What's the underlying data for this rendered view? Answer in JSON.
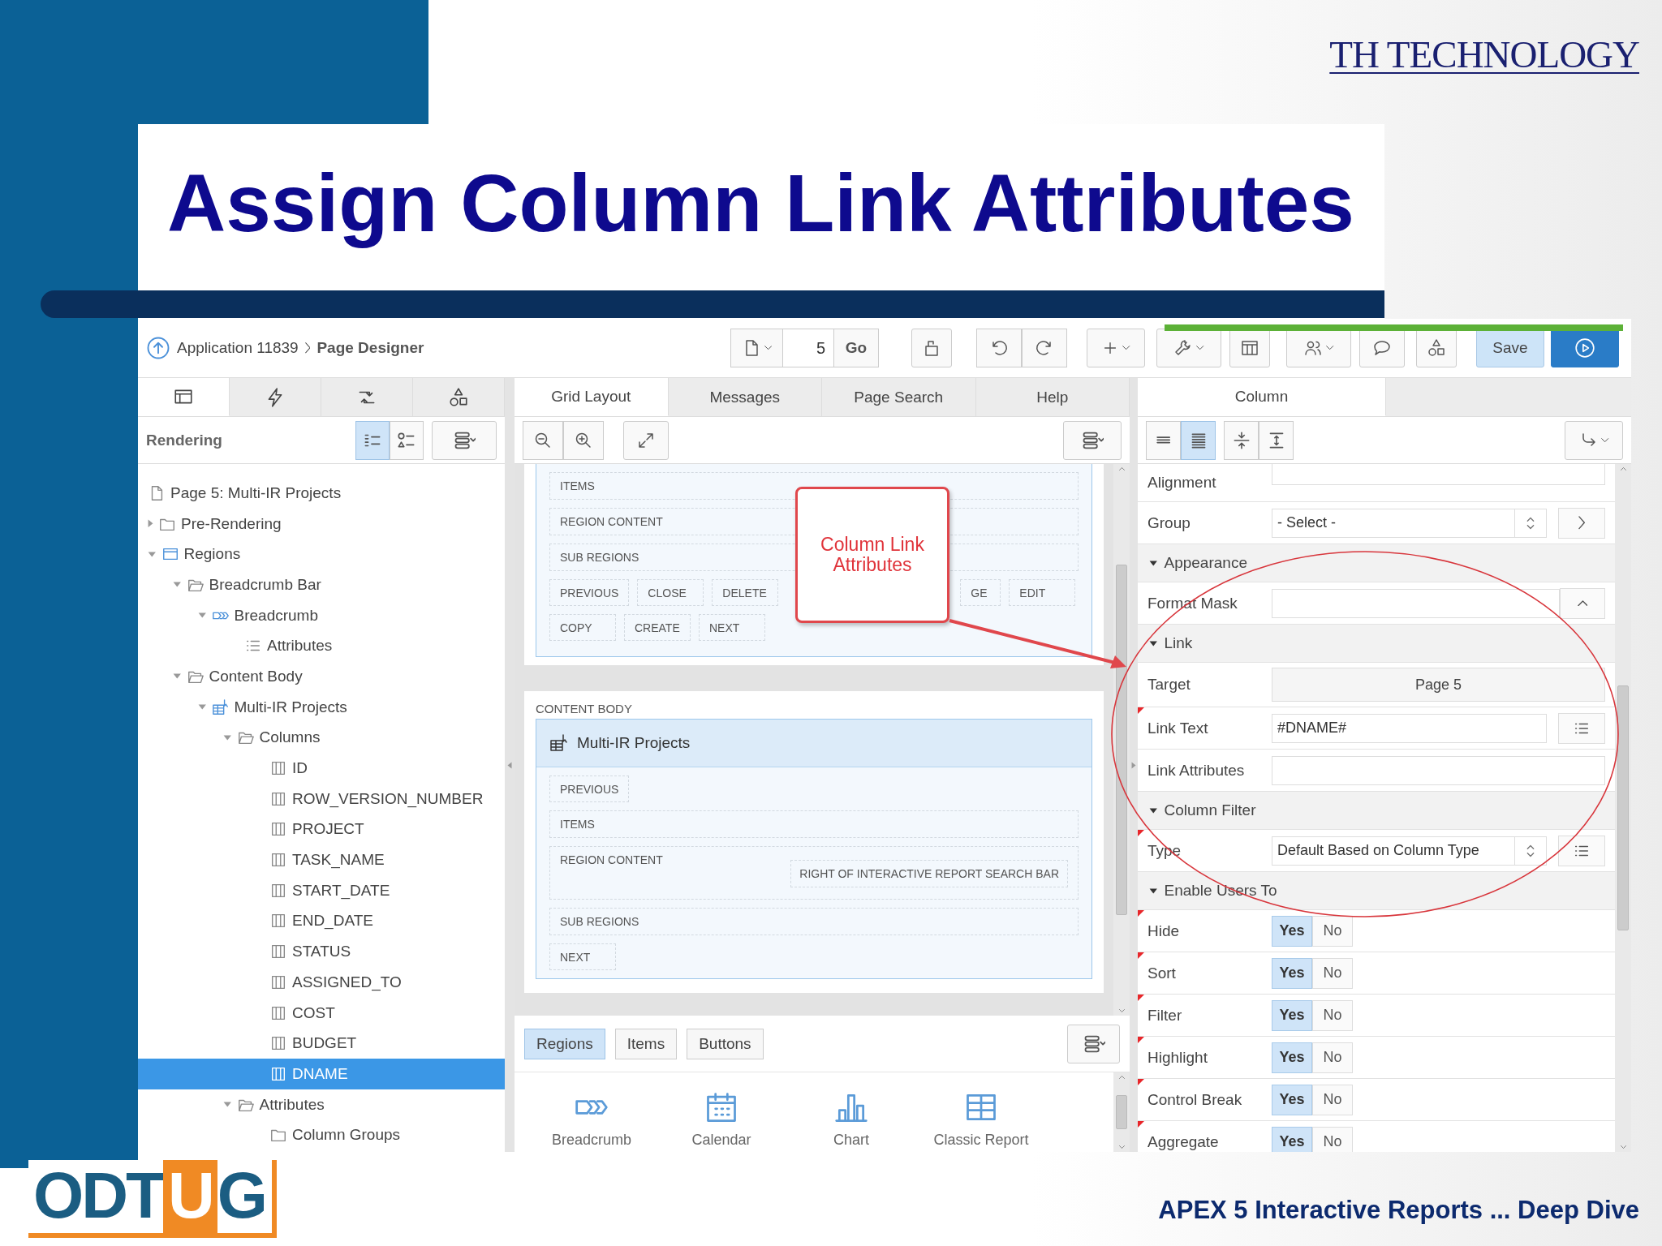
{
  "slide": {
    "brand": "TH TECHNOLOGY",
    "title": "Assign Column Link Attributes",
    "logo": [
      {
        "text": "ODT",
        "highlight": false
      },
      {
        "text": "U",
        "highlight": true
      },
      {
        "text": "G",
        "highlight": false
      }
    ],
    "footer": "APEX 5 Interactive Reports ... Deep Dive"
  },
  "app": {
    "breadcrumb": [
      {
        "label": "Application 11839",
        "current": false
      },
      {
        "label": "Page Designer",
        "current": true
      }
    ],
    "page_number": "5",
    "go": "Go",
    "save": "Save"
  },
  "left": {
    "tabs": [
      {
        "kind": "rendering",
        "selected": true
      },
      {
        "kind": "dynamic-actions",
        "selected": false
      },
      {
        "kind": "processing",
        "selected": false
      },
      {
        "kind": "shared",
        "selected": false
      }
    ],
    "heading": "Rendering",
    "views": [
      {
        "kind": "tree",
        "selected": true
      },
      {
        "kind": "components",
        "selected": false
      }
    ],
    "tree": [
      {
        "kind": "page",
        "label": "Page 5: Multi-IR Projects",
        "selected": false
      },
      {
        "kind": "folder",
        "label": "Pre-Rendering",
        "expanded": false,
        "selected": false
      },
      {
        "kind": "region",
        "label": "Regions",
        "expanded": true,
        "selected": false,
        "children": [
          {
            "kind": "folder",
            "label": "Breadcrumb Bar",
            "expanded": true,
            "selected": false,
            "children": [
              {
                "kind": "breadcrumb",
                "label": "Breadcrumb",
                "expanded": true,
                "selected": false,
                "children": [
                  {
                    "kind": "attributes",
                    "label": "Attributes",
                    "selected": false
                  }
                ]
              }
            ]
          },
          {
            "kind": "folder",
            "label": "Content Body",
            "expanded": true,
            "selected": false,
            "children": [
              {
                "kind": "report",
                "label": "Multi-IR Projects",
                "expanded": true,
                "selected": false,
                "children": [
                  {
                    "kind": "folder",
                    "label": "Columns",
                    "expanded": true,
                    "selected": false,
                    "children": [
                      {
                        "kind": "column",
                        "label": "ID",
                        "selected": false
                      },
                      {
                        "kind": "column",
                        "label": "ROW_VERSION_NUMBER",
                        "selected": false
                      },
                      {
                        "kind": "column",
                        "label": "PROJECT",
                        "selected": false
                      },
                      {
                        "kind": "column",
                        "label": "TASK_NAME",
                        "selected": false
                      },
                      {
                        "kind": "column",
                        "label": "START_DATE",
                        "selected": false
                      },
                      {
                        "kind": "column",
                        "label": "END_DATE",
                        "selected": false
                      },
                      {
                        "kind": "column",
                        "label": "STATUS",
                        "selected": false
                      },
                      {
                        "kind": "column",
                        "label": "ASSIGNED_TO",
                        "selected": false
                      },
                      {
                        "kind": "column",
                        "label": "COST",
                        "selected": false
                      },
                      {
                        "kind": "column",
                        "label": "BUDGET",
                        "selected": false
                      },
                      {
                        "kind": "column",
                        "label": "DNAME",
                        "selected": true
                      }
                    ]
                  },
                  {
                    "kind": "folder",
                    "label": "Attributes",
                    "expanded": true,
                    "selected": false,
                    "children": [
                      {
                        "kind": "folder",
                        "label": "Column Groups",
                        "selected": false
                      }
                    ]
                  }
                ]
              }
            ]
          }
        ]
      }
    ]
  },
  "center": {
    "tabs": [
      {
        "label": "Grid Layout",
        "selected": true
      },
      {
        "label": "Messages",
        "selected": false
      },
      {
        "label": "Page Search",
        "selected": false
      },
      {
        "label": "Help",
        "selected": false
      }
    ],
    "grid": [
      {
        "slots": [
          {
            "kind": "row",
            "label": "ITEMS"
          },
          {
            "kind": "row",
            "label": "REGION CONTENT"
          },
          {
            "kind": "row",
            "label": "SUB REGIONS"
          },
          {
            "kind": "buttons",
            "items": [
              "PREVIOUS",
              "CLOSE",
              "DELETE",
              "GE",
              "EDIT"
            ]
          },
          {
            "kind": "buttons",
            "items": [
              "COPY",
              "CREATE",
              "NEXT"
            ]
          }
        ]
      },
      {
        "label": "CONTENT BODY",
        "title": "Multi-IR Projects",
        "slots": [
          {
            "kind": "buttons",
            "items": [
              "PREVIOUS"
            ]
          },
          {
            "kind": "row",
            "label": "ITEMS"
          },
          {
            "kind": "row",
            "label": "REGION CONTENT",
            "inner": "RIGHT OF INTERACTIVE REPORT SEARCH BAR"
          },
          {
            "kind": "row",
            "label": "SUB REGIONS"
          },
          {
            "kind": "buttons",
            "items": [
              "NEXT"
            ]
          }
        ]
      }
    ],
    "gallery_tabs": [
      {
        "label": "Regions",
        "selected": true
      },
      {
        "label": "Items",
        "selected": false
      },
      {
        "label": "Buttons",
        "selected": false
      }
    ],
    "gallery": [
      {
        "kind": "breadcrumb",
        "label": "Breadcrumb"
      },
      {
        "kind": "calendar",
        "label": "Calendar"
      },
      {
        "kind": "chart",
        "label": "Chart"
      },
      {
        "kind": "classic-report",
        "label": "Classic Report"
      }
    ]
  },
  "right": {
    "tabs": [
      {
        "label": "Column",
        "selected": true
      }
    ],
    "views": [
      {
        "kind": "compact",
        "selected": false
      },
      {
        "kind": "full",
        "selected": true
      },
      {
        "kind": "collapse",
        "selected": false
      },
      {
        "kind": "expand",
        "selected": false
      }
    ],
    "properties": [
      {
        "kind": "text",
        "label": "Alignment",
        "modified": false
      },
      {
        "kind": "select",
        "label": "Group",
        "value": "- Select -",
        "extra": {
          "kind": "next"
        },
        "modified": false
      },
      {
        "kind": "group",
        "label": "Appearance",
        "expanded": true,
        "modified": false
      },
      {
        "kind": "text",
        "label": "Format Mask",
        "extra": {
          "kind": "up"
        },
        "modified": false
      },
      {
        "kind": "group",
        "label": "Link",
        "expanded": true,
        "modified": false
      },
      {
        "kind": "link-button",
        "label": "Target",
        "value": "Page 5",
        "modified": false
      },
      {
        "kind": "text",
        "label": "Link Text",
        "value": "#DNAME#",
        "extra": {
          "kind": "list"
        },
        "modified": true
      },
      {
        "kind": "text",
        "label": "Link Attributes",
        "modified": false
      },
      {
        "kind": "group",
        "label": "Column Filter",
        "expanded": true,
        "modified": false
      },
      {
        "kind": "select",
        "label": "Type",
        "value": "Default Based on Column Type",
        "extra": {
          "kind": "list"
        },
        "modified": true
      },
      {
        "kind": "group",
        "label": "Enable Users To",
        "expanded": true,
        "modified": false
      },
      {
        "kind": "toggle",
        "label": "Hide",
        "modified": true,
        "options": [
          {
            "label": "Yes",
            "selected": true
          },
          {
            "label": "No",
            "selected": false
          }
        ]
      },
      {
        "kind": "toggle",
        "label": "Sort",
        "modified": true,
        "options": [
          {
            "label": "Yes",
            "selected": true
          },
          {
            "label": "No",
            "selected": false
          }
        ]
      },
      {
        "kind": "toggle",
        "label": "Filter",
        "modified": true,
        "options": [
          {
            "label": "Yes",
            "selected": true
          },
          {
            "label": "No",
            "selected": false
          }
        ]
      },
      {
        "kind": "toggle",
        "label": "Highlight",
        "modified": true,
        "options": [
          {
            "label": "Yes",
            "selected": true
          },
          {
            "label": "No",
            "selected": false
          }
        ]
      },
      {
        "kind": "toggle",
        "label": "Control Break",
        "modified": true,
        "options": [
          {
            "label": "Yes",
            "selected": true
          },
          {
            "label": "No",
            "selected": false
          }
        ]
      },
      {
        "kind": "toggle",
        "label": "Aggregate",
        "modified": true,
        "options": [
          {
            "label": "Yes",
            "selected": true
          },
          {
            "label": "No",
            "selected": false
          }
        ]
      }
    ]
  },
  "annotation": {
    "callout": "Column Link Attributes"
  }
}
